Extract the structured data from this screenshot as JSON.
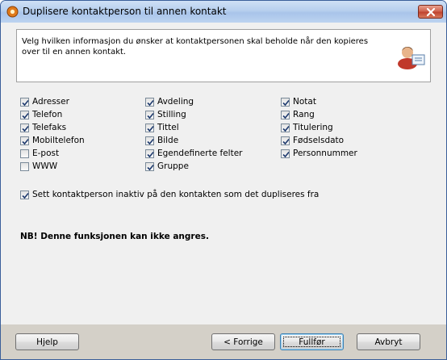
{
  "window": {
    "title": "Duplisere kontaktperson til annen kontakt",
    "app_icon": "gear-icon",
    "close_icon": "close-icon"
  },
  "description": {
    "text": "Velg hvilken informasjon du ønsker at kontaktpersonen skal beholde når den kopieres over til en annen kontakt.",
    "icon": "person-card-icon"
  },
  "options": {
    "col1": [
      {
        "label": "Adresser",
        "checked": true
      },
      {
        "label": "Telefon",
        "checked": true
      },
      {
        "label": "Telefaks",
        "checked": true
      },
      {
        "label": "Mobiltelefon",
        "checked": true
      },
      {
        "label": "E-post",
        "checked": false
      },
      {
        "label": "WWW",
        "checked": false
      }
    ],
    "col2": [
      {
        "label": "Avdeling",
        "checked": true
      },
      {
        "label": "Stilling",
        "checked": true
      },
      {
        "label": "Tittel",
        "checked": true
      },
      {
        "label": "Bilde",
        "checked": true
      },
      {
        "label": "Egendefinerte felter",
        "checked": true
      },
      {
        "label": "Gruppe",
        "checked": true
      }
    ],
    "col3": [
      {
        "label": "Notat",
        "checked": true
      },
      {
        "label": "Rang",
        "checked": true
      },
      {
        "label": "Titulering",
        "checked": true
      },
      {
        "label": "Fødselsdato",
        "checked": true
      },
      {
        "label": "Personnummer",
        "checked": true
      }
    ]
  },
  "inactive_option": {
    "label": "Sett kontaktperson inaktiv på den kontakten som det dupliseres fra",
    "checked": true
  },
  "warning": "NB! Denne funksjonen kan ikke angres.",
  "buttons": {
    "help": "Hjelp",
    "previous": "< Forrige",
    "finish": "Fullfør",
    "cancel": "Avbryt"
  }
}
